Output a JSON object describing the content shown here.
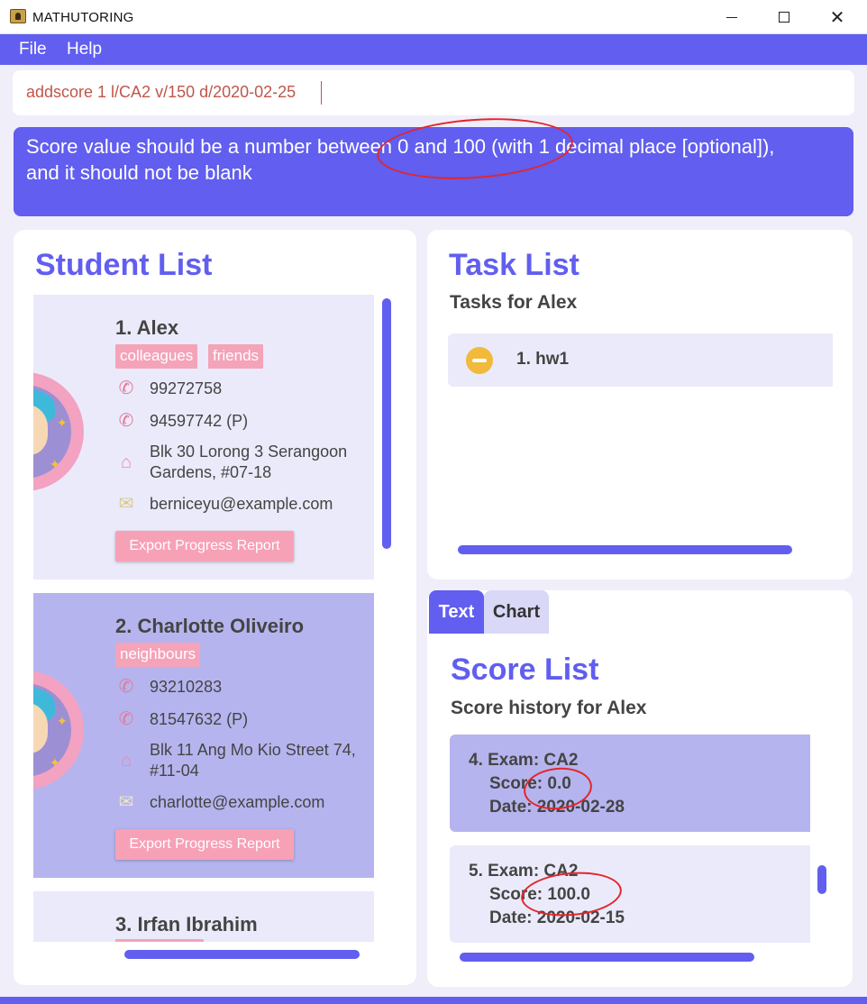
{
  "window": {
    "title": "MATHUTORING"
  },
  "menu": {
    "file": "File",
    "help": "Help"
  },
  "command": {
    "value": "addscore 1 l/CA2 v/150 d/2020-02-25"
  },
  "result": {
    "line1": "Score value should be a number between 0 and 100 (with 1 decimal place [optional]),",
    "line2": "and it should not be blank"
  },
  "student_list": {
    "title": "Student List",
    "students": [
      {
        "name": "1.  Alex",
        "tags": [
          "colleagues",
          "friends"
        ],
        "phone": "99272758",
        "parent_phone": "94597742 (P)",
        "address_line1": "Blk 30 Lorong 3 Serangoon",
        "address_line2": "Gardens, #07-18",
        "email": "berniceyu@example.com",
        "button": "Export Progress Report"
      },
      {
        "name": "2.  Charlotte Oliveiro",
        "tags": [
          "neighbours"
        ],
        "phone": "93210283",
        "parent_phone": "81547632 (P)",
        "address_line1": "Blk 11 Ang Mo Kio Street 74,",
        "address_line2": "#11-04",
        "email": "charlotte@example.com",
        "button": "Export Progress Report"
      },
      {
        "name": "3.  Irfan Ibrahim"
      }
    ]
  },
  "task_list": {
    "title": "Task List",
    "subtitle": "Tasks for Alex",
    "tasks": [
      {
        "label": "1. hw1",
        "status_icon": "in-progress-icon"
      }
    ]
  },
  "score_tabs": {
    "text": "Text",
    "chart": "Chart",
    "active": "Text"
  },
  "score_list": {
    "title": "Score List",
    "subtitle": "Score history for Alex",
    "scores": [
      {
        "exam": "4. Exam: CA2",
        "score": "Score: 0.0",
        "date": "Date: 2020-02-28"
      },
      {
        "exam": "5. Exam: CA2",
        "score": "Score: 100.0",
        "date": "Date: 2020-02-15"
      }
    ]
  },
  "colors": {
    "accent": "#615ef0",
    "tag": "#f4a3b9",
    "annotation": "#e3262b"
  }
}
